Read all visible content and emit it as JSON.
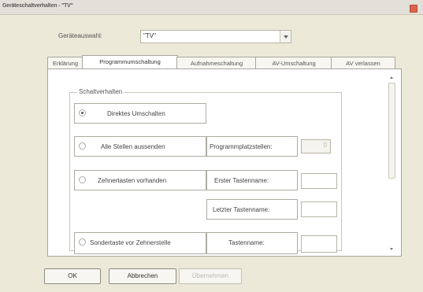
{
  "window": {
    "title": "Geräteschaltverhalten - \"TV\""
  },
  "device_select": {
    "label": "Geräteauswahl:",
    "value": "\"TV\""
  },
  "tabs": [
    {
      "label": "Erklärung"
    },
    {
      "label": "Programmumschaltung"
    },
    {
      "label": "Aufnahmeschaltung"
    },
    {
      "label": "AV-Umschaltung"
    },
    {
      "label": "AV verlassen"
    }
  ],
  "active_tab": "Programmumschaltung",
  "group": {
    "label": "Schaltverhalten"
  },
  "options": {
    "direct": {
      "label": "Direktes Umschalten",
      "selected": true
    },
    "all_stations": {
      "label": "Alle Stellen aussenden",
      "field_label": "Programmplatzstellen:",
      "field_value": "0"
    },
    "number_keys": {
      "label": "Zehnertasten vorhanden",
      "first_label": "Erster Tastenname:",
      "last_label": "Letzter Tastenname:"
    },
    "special_key": {
      "label": "Sondertaste vor Zehnerstelle",
      "field_label": "Tastenname:"
    }
  },
  "buttons": {
    "ok": "OK",
    "cancel": "Abbrechen",
    "apply": "Übernehmen"
  },
  "colors": {
    "window_bg": "#ece9d8",
    "panel_bg": "#ffffff",
    "close_button": "#d9644c"
  }
}
